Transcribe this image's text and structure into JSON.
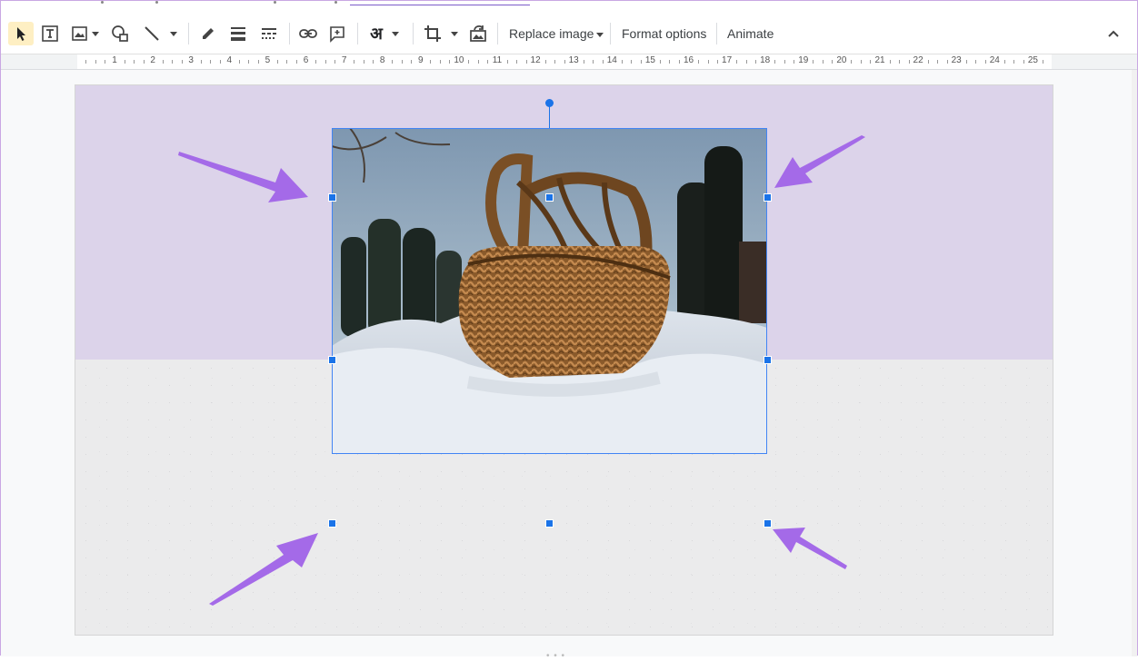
{
  "toolbar": {
    "tools": [
      {
        "name": "select-tool",
        "icon": "cursor-icon"
      },
      {
        "name": "text-box-tool",
        "icon": "text-box-icon"
      },
      {
        "name": "insert-image-tool",
        "icon": "image-icon"
      },
      {
        "name": "shape-tool",
        "icon": "shape-icon"
      },
      {
        "name": "line-tool",
        "icon": "line-icon"
      },
      {
        "name": "border-color-tool",
        "icon": "pencil-icon"
      },
      {
        "name": "border-weight-tool",
        "icon": "border-weight-icon"
      },
      {
        "name": "border-dash-tool",
        "icon": "border-dash-icon"
      },
      {
        "name": "insert-link-tool",
        "icon": "link-icon"
      },
      {
        "name": "add-comment-tool",
        "icon": "comment-icon"
      },
      {
        "name": "input-tools",
        "icon": "input-tools-icon"
      },
      {
        "name": "crop-tool",
        "icon": "crop-icon"
      },
      {
        "name": "reset-image-tool",
        "icon": "reset-image-icon"
      }
    ],
    "input_tools_glyph": "अ",
    "replace_image_label": "Replace image",
    "format_options_label": "Format options",
    "animate_label": "Animate",
    "active_color": "#feefc3"
  },
  "ruler": {
    "numbers": [
      "1",
      "2",
      "3",
      "4",
      "5",
      "6",
      "7",
      "8",
      "9",
      "10",
      "11",
      "12",
      "13",
      "14",
      "15",
      "16",
      "17",
      "18",
      "19",
      "20",
      "21",
      "22",
      "23",
      "24",
      "25"
    ]
  },
  "slide": {
    "top_color": "#dcd3ea",
    "bottom_color": "#ebebec",
    "image_description": "wicker-basket-in-snow",
    "selection_color": "#1a73e8",
    "arrow_color": "#a46ae8"
  }
}
